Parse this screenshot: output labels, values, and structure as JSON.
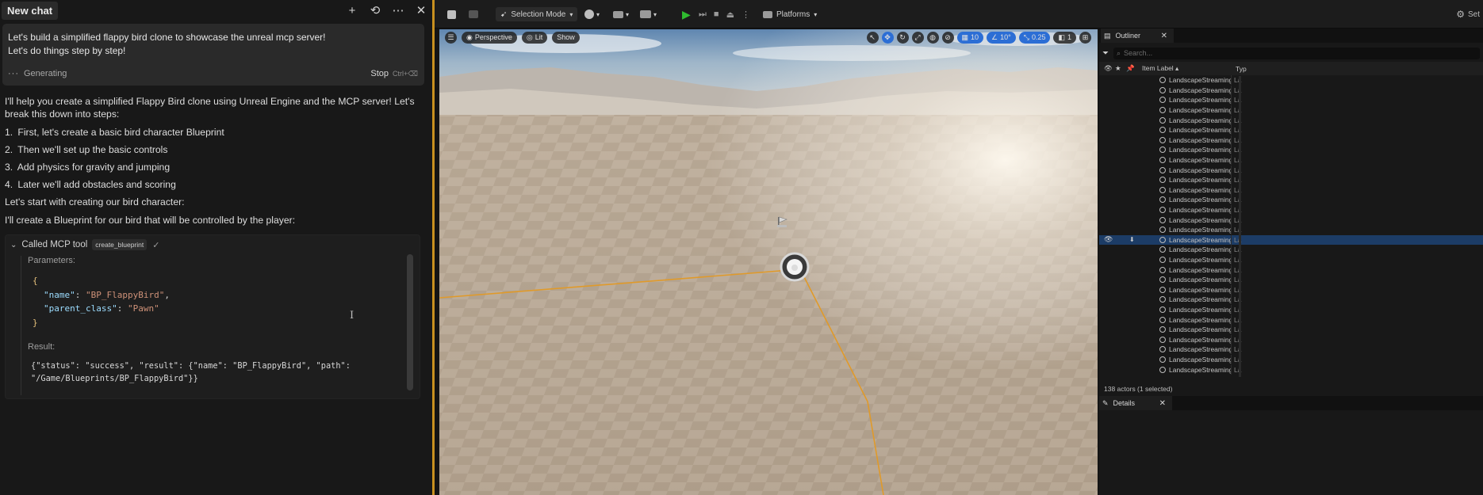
{
  "chat": {
    "tab_title": "New chat",
    "actions": [
      {
        "name": "new-chat",
        "glyph": "+"
      },
      {
        "name": "history",
        "glyph": "⟲"
      },
      {
        "name": "more",
        "glyph": "⋯"
      },
      {
        "name": "close",
        "glyph": "✕"
      }
    ],
    "prompt": "Let's build a simplified flappy bird clone to showcase the unreal mcp server!\nLet's do things step by step!",
    "status": "Generating",
    "stop_label": "Stop",
    "stop_shortcut": "Ctrl+⌫",
    "response_intro": "I'll help you create a simplified Flappy Bird clone using Unreal Engine and the MCP server! Let's break this down into steps:",
    "steps": [
      {
        "num": "1.",
        "text": "First, let's create a basic bird character Blueprint"
      },
      {
        "num": "2.",
        "text": "Then we'll set up the basic controls"
      },
      {
        "num": "3.",
        "text": "Add physics for gravity and jumping"
      },
      {
        "num": "4.",
        "text": "Later we'll add obstacles and scoring"
      }
    ],
    "after_steps_1": "Let's start with creating our bird character:",
    "after_steps_2": "I'll create a Blueprint for our bird that will be controlled by the player:",
    "tool_call": {
      "label": "Called MCP tool",
      "tool_name": "create_blueprint",
      "check_glyph": "✓",
      "params_label": "Parameters:",
      "open_brace": "{",
      "close_brace": "}",
      "params": [
        {
          "key": "\"name\"",
          "colon": ": ",
          "value": "\"BP_FlappyBird\"",
          "trail": ","
        },
        {
          "key": "\"parent_class\"",
          "colon": ": ",
          "value": "\"Pawn\"",
          "trail": ""
        }
      ],
      "result_label": "Result:",
      "result_text": "{\"status\": \"success\", \"result\": {\"name\": \"BP_FlappyBird\", \"path\":\n\"/Game/Blueprints/BP_FlappyBird\"}}"
    }
  },
  "editor": {
    "toolbar": {
      "selection_mode": "Selection Mode",
      "platforms": "Platforms",
      "settings": "Set"
    },
    "viewport": {
      "perspective": "Perspective",
      "lit": "Lit",
      "show": "Show",
      "grid_snap": "10",
      "rotate_snap": "10°",
      "scale_snap": "0.25",
      "camera_speed": "1"
    },
    "outliner": {
      "tab_label": "Outliner",
      "search_placeholder": "Search...",
      "col_label": "Item Label ▴",
      "col_type": "Typ",
      "rows": [
        {
          "label": "LandscapeStreamingProxy",
          "type": "La",
          "selected": false
        },
        {
          "label": "LandscapeStreamingProxy",
          "type": "La",
          "selected": false
        },
        {
          "label": "LandscapeStreamingProxy",
          "type": "La",
          "selected": false
        },
        {
          "label": "LandscapeStreamingProxy",
          "type": "La",
          "selected": false
        },
        {
          "label": "LandscapeStreamingProxy",
          "type": "La",
          "selected": false
        },
        {
          "label": "LandscapeStreamingProxy",
          "type": "La",
          "selected": false
        },
        {
          "label": "LandscapeStreamingProxy",
          "type": "La",
          "selected": false
        },
        {
          "label": "LandscapeStreamingProxy",
          "type": "La",
          "selected": false
        },
        {
          "label": "LandscapeStreamingProxy",
          "type": "La",
          "selected": false
        },
        {
          "label": "LandscapeStreamingProxy",
          "type": "La",
          "selected": false
        },
        {
          "label": "LandscapeStreamingProxy",
          "type": "La",
          "selected": false
        },
        {
          "label": "LandscapeStreamingProxy",
          "type": "La",
          "selected": false
        },
        {
          "label": "LandscapeStreamingProxy",
          "type": "La",
          "selected": false
        },
        {
          "label": "LandscapeStreamingProxy",
          "type": "La",
          "selected": false
        },
        {
          "label": "LandscapeStreamingProxy",
          "type": "La",
          "selected": false
        },
        {
          "label": "LandscapeStreamingProxy",
          "type": "La",
          "selected": false
        },
        {
          "label": "LandscapeStreamingProxy",
          "type": "La",
          "selected": true
        },
        {
          "label": "LandscapeStreamingProxy",
          "type": "La",
          "selected": false
        },
        {
          "label": "LandscapeStreamingProxy",
          "type": "La",
          "selected": false
        },
        {
          "label": "LandscapeStreamingProxy",
          "type": "La",
          "selected": false
        },
        {
          "label": "LandscapeStreamingProxy",
          "type": "La",
          "selected": false
        },
        {
          "label": "LandscapeStreamingProxy",
          "type": "La",
          "selected": false
        },
        {
          "label": "LandscapeStreamingProxy",
          "type": "La",
          "selected": false
        },
        {
          "label": "LandscapeStreamingProxy",
          "type": "La",
          "selected": false
        },
        {
          "label": "LandscapeStreamingProxy",
          "type": "La",
          "selected": false
        },
        {
          "label": "LandscapeStreamingProxy",
          "type": "La",
          "selected": false
        },
        {
          "label": "LandscapeStreamingProxy",
          "type": "La",
          "selected": false
        },
        {
          "label": "LandscapeStreamingProxy",
          "type": "La",
          "selected": false
        },
        {
          "label": "LandscapeStreamingProxy",
          "type": "La",
          "selected": false
        },
        {
          "label": "LandscapeStreamingProxy",
          "type": "La",
          "selected": false
        }
      ],
      "status": "138 actors (1 selected)"
    },
    "details": {
      "tab_label": "Details"
    }
  },
  "colors": {
    "accent_play": "#2fbb2f",
    "selection_outline": "#e09a2a",
    "splitter": "#c8901f",
    "outliner_selected": "#1c3c66"
  }
}
